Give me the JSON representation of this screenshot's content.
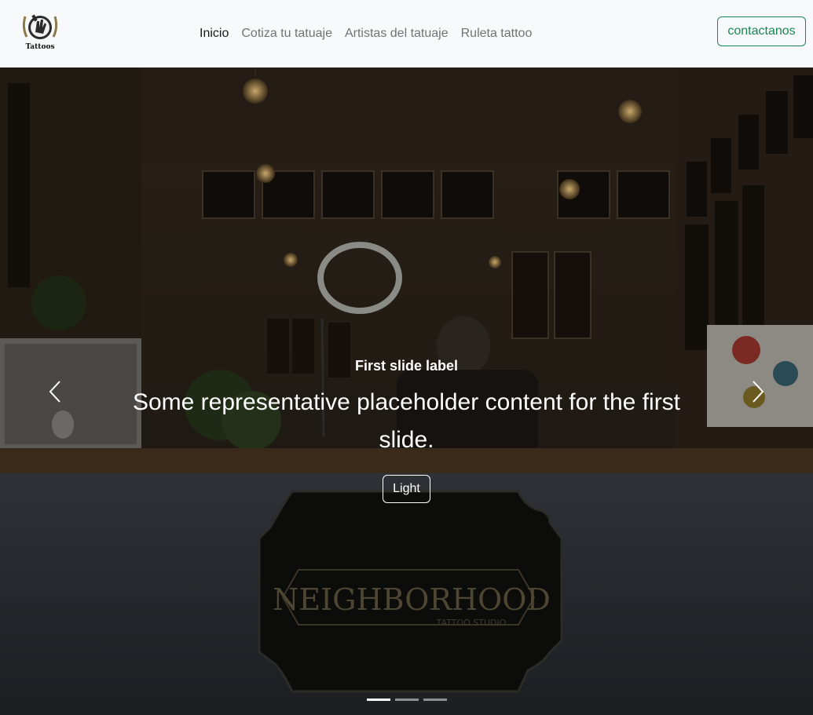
{
  "brand": {
    "logo_icon": "tattoo-logo-icon",
    "logo_text": "Tattoos"
  },
  "nav": {
    "links": [
      {
        "label": "Inicio",
        "active": true
      },
      {
        "label": "Cotiza tu tatuaje",
        "active": false
      },
      {
        "label": "Artistas del tatuaje",
        "active": false
      },
      {
        "label": "Ruleta tattoo",
        "active": false
      }
    ],
    "contact_label": "contactanos"
  },
  "carousel": {
    "slide_label": "First slide label",
    "slide_text": "Some representative placeholder content for the first slide.",
    "button_label": "Light",
    "sign_text": "NEIGHBORHOOD",
    "sign_subtext": "TATTOO STUDIO",
    "prev_icon": "chevron-left-icon",
    "next_icon": "chevron-right-icon",
    "indicator_count": 3,
    "active_index": 0
  },
  "colors": {
    "accent": "#198754",
    "navbar_bg": "#f8f9fa"
  }
}
